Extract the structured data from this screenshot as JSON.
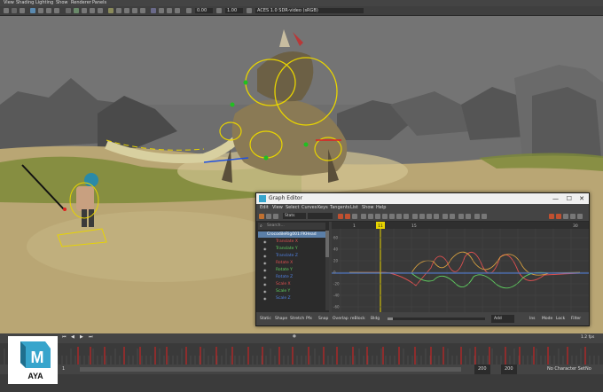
{
  "main_menu": [
    "View",
    "Shading",
    "Lighting",
    "Show",
    "Renderer",
    "Panels"
  ],
  "panel_toolbar": {
    "exposure": "0.00",
    "gamma": "1.00",
    "colorspace": "ACES 1.0 SDR-video (sRGB)"
  },
  "graph_editor": {
    "title": "Graph Editor",
    "menu": [
      "Edit",
      "View",
      "Select",
      "Curves",
      "Keys",
      "Tangents",
      "List",
      "Show",
      "Help"
    ],
    "stats_label": "Stats",
    "search_placeholder": "Search...",
    "outliner": {
      "root": "CrocodileRig001:FKHead",
      "items": [
        {
          "label": "Translate X",
          "color": "#e05050"
        },
        {
          "label": "Translate Y",
          "color": "#60d060"
        },
        {
          "label": "Translate Z",
          "color": "#5080e0"
        },
        {
          "label": "Rotate X",
          "color": "#e05050"
        },
        {
          "label": "Rotate Y",
          "color": "#60d060"
        },
        {
          "label": "Rotate Z",
          "color": "#5080e0"
        },
        {
          "label": "Scale X",
          "color": "#e05050"
        },
        {
          "label": "Scale Y",
          "color": "#60d060"
        },
        {
          "label": "Scale Z",
          "color": "#5080e0"
        }
      ]
    },
    "timeline_ticks": [
      "1",
      "15",
      "30"
    ],
    "current_frame": "11",
    "y_ticks": [
      "60",
      "40",
      "20",
      "0",
      "-20",
      "-40",
      "-60"
    ],
    "bottom_buttons": [
      "Static",
      "Shape",
      "Stretch",
      "Pfx",
      "Snap",
      "Overlap",
      "reBlock",
      "Bldg"
    ],
    "bottom_right": [
      "Add",
      "Ins",
      "Mode",
      "Lock",
      "Filter"
    ]
  },
  "time_slider": {
    "start": "1",
    "end": "200",
    "current_label": "1.2 fps",
    "range_start": "200",
    "range_end": "200",
    "character_set": "No Character Set",
    "anim_layer": "No Anim"
  },
  "logo": {
    "letter": "M",
    "text": "AYA"
  },
  "colors": {
    "accent": "#e8d400",
    "maya_teal": "#37a5cc",
    "key_red": "#e02020"
  }
}
